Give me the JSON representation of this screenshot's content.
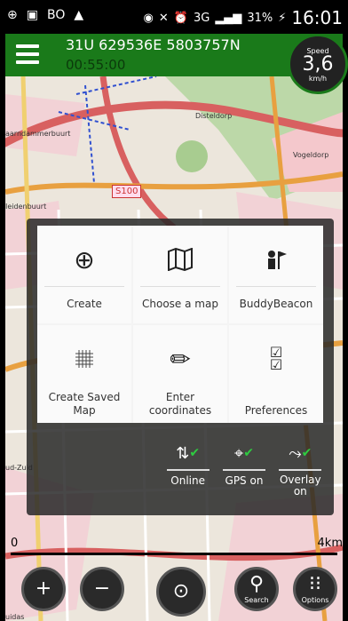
{
  "status_bar": {
    "battery": "31%",
    "signal": "3G",
    "time": "16:01"
  },
  "header": {
    "coordinates": "31U 629536E 5803757N",
    "timer": "00:55:00"
  },
  "speed": {
    "label": "Speed",
    "value": "3,6",
    "unit": "km/h"
  },
  "map": {
    "road_label": "S100",
    "labels": [
      "Disteldorp",
      "Vogeldorp",
      "aarndammerbuurt",
      "Ieidenbuurt",
      "ud-Zuid",
      "uidas"
    ]
  },
  "menu": {
    "items": [
      {
        "label": "Create",
        "icon": "plus-circle-icon"
      },
      {
        "label": "Choose a map",
        "icon": "map-icon"
      },
      {
        "label": "BuddyBeacon",
        "icon": "buddy-beacon-icon"
      },
      {
        "label": "Create Saved Map",
        "icon": "grid-icon"
      },
      {
        "label": "Enter coordinates",
        "icon": "pencil-icon"
      },
      {
        "label": "Preferences",
        "icon": "checkbox-icon"
      }
    ]
  },
  "toggles": [
    {
      "label": "Online",
      "icon": "online-arrows-icon"
    },
    {
      "label": "GPS on",
      "icon": "gps-icon"
    },
    {
      "label": "Overlay on",
      "icon": "overlay-icon"
    }
  ],
  "scale": {
    "start": "0",
    "end": "4km"
  },
  "bottom_buttons": {
    "search": "Search",
    "options": "Options"
  },
  "colors": {
    "topbar": "#1a7a1a",
    "check": "#2ecc40"
  }
}
